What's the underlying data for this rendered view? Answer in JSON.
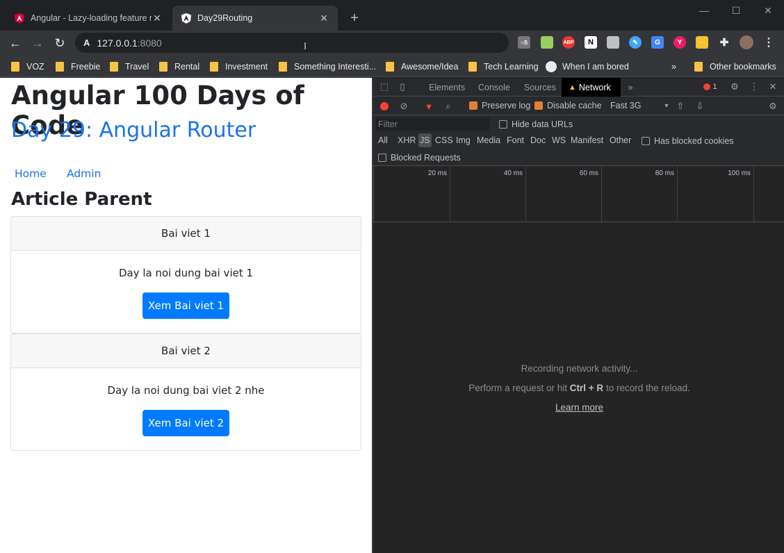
{
  "browser": {
    "tabs": [
      {
        "title": "Angular - Lazy-loading feature m",
        "favicon": "angular-red-icon"
      },
      {
        "title": "Day29Routing",
        "favicon": "angular-dark-icon"
      }
    ],
    "url_host": "127.0.0.1",
    "url_port": ":8080",
    "bookmarks": [
      "VOZ",
      "Freebie",
      "Travel",
      "Rental",
      "Investment",
      "Something Interesti...",
      "Awesome/Idea",
      "Tech Learning",
      "When I am bored"
    ],
    "other_bookmarks": "Other bookmarks",
    "overflow": "»"
  },
  "page": {
    "title": "Angular 100 Days of Code",
    "subtitle": "Day 29: Angular Router",
    "nav": [
      "Home",
      "Admin"
    ],
    "section_title": "Article Parent",
    "articles": [
      {
        "header": "Bai viet 1",
        "text": "Day la noi dung bai viet 1",
        "button": "Xem Bai viet 1"
      },
      {
        "header": "Bai viet 2",
        "text": "Day la noi dung bai viet 2 nhe",
        "button": "Xem Bai viet 2"
      }
    ]
  },
  "devtools": {
    "tabs": [
      "Elements",
      "Console",
      "Sources",
      "Network"
    ],
    "active_tab": "Network",
    "error_count": "1",
    "preserve_log": "Preserve log",
    "disable_cache": "Disable cache",
    "throttle": "Fast 3G",
    "filter_placeholder": "Filter",
    "hide_data_urls": "Hide data URLs",
    "type_filters": [
      "All",
      "XHR",
      "JS",
      "CSS",
      "Img",
      "Media",
      "Font",
      "Doc",
      "WS",
      "Manifest",
      "Other"
    ],
    "has_blocked_cookies": "Has blocked cookies",
    "blocked_requests": "Blocked Requests",
    "timeline_ticks": [
      "20 ms",
      "40 ms",
      "60 ms",
      "80 ms",
      "100 ms"
    ],
    "empty_line1": "Recording network activity...",
    "empty_line2_pre": "Perform a request or hit ",
    "empty_line2_key": "Ctrl + R",
    "empty_line2_post": " to record the reload.",
    "learn_more": "Learn more"
  },
  "colors": {
    "link": "#1a73e8",
    "button": "#007bff",
    "devtools_bg": "#242424",
    "record": "#f44336"
  }
}
